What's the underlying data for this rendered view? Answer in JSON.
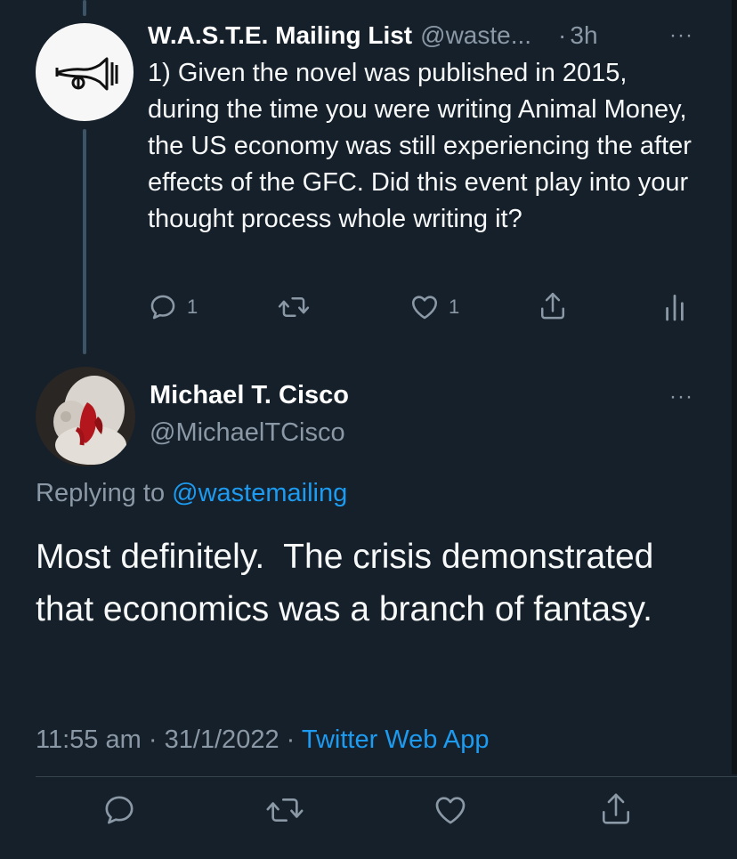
{
  "parent_tweet": {
    "author_name": "W.A.S.T.E. Mailing List",
    "author_handle": "@waste...",
    "separator": "·",
    "time": "3h",
    "more": "···",
    "text": "1) Given the novel was published in 2015, during the time you were writing Animal Money, the US economy was still experiencing the after effects of the GFC. Did this event play into your thought process whole writing it?",
    "actions": {
      "reply_count": "1",
      "retweet_count": "",
      "like_count": "1"
    },
    "avatar_icon": "post-horn-logo"
  },
  "reply_tweet": {
    "author_name": "Michael T. Cisco",
    "author_handle": "@MichaelTCisco",
    "more": "···",
    "replying_prefix": "Replying to",
    "replying_to": "@wastemailing",
    "text": "Most definitely.  The crisis demonstrated that economics was a branch of fantasy.",
    "time": "11:55 am",
    "date": "31/1/2022",
    "meta_separator": "·",
    "source": "Twitter Web App"
  },
  "colors": {
    "background": "#15202b",
    "text": "#f7f9f9",
    "muted": "#8b98a5",
    "link": "#1d9bf0",
    "thread_line": "#3d5466"
  }
}
